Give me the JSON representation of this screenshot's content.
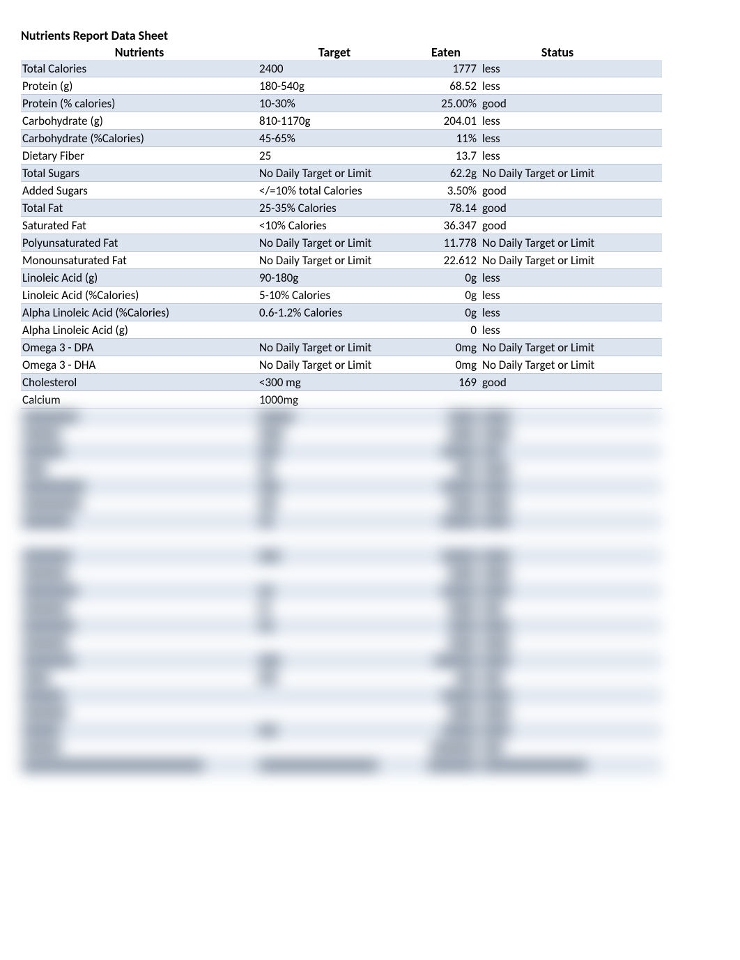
{
  "title": "Nutrients Report Data Sheet",
  "headers": {
    "nutrients": "Nutrients",
    "target": "Target",
    "eaten": "Eaten",
    "status": "Status"
  },
  "rows": [
    {
      "nutrient": "Total Calories",
      "target": "2400",
      "eaten": "1777",
      "status": "less",
      "alt": true
    },
    {
      "nutrient": "Protein (g)",
      "target": "180-540g",
      "eaten": "68.52",
      "status": "less",
      "alt": false
    },
    {
      "nutrient": "Protein (% calories)",
      "target": "10-30%",
      "eaten": "25.00%",
      "status": "good",
      "alt": true
    },
    {
      "nutrient": "Carbohydrate (g)",
      "target": "810-1170g",
      "eaten": "204.01",
      "status": "less",
      "alt": false
    },
    {
      "nutrient": "Carbohydrate (%Calories)",
      "target": "45-65%",
      "eaten": "11%",
      "status": "less",
      "alt": true
    },
    {
      "nutrient": "Dietary Fiber",
      "target": "25",
      "eaten": "13.7",
      "status": "less",
      "alt": false
    },
    {
      "nutrient": "Total Sugars",
      "target": "No Daily Target or Limit",
      "eaten": "62.2g",
      "status": "No Daily Target or Limit",
      "alt": true
    },
    {
      "nutrient": "Added Sugars",
      "target": "</=10% total Calories",
      "eaten": "3.50%",
      "status": "good",
      "alt": false
    },
    {
      "nutrient": "Total Fat",
      "target": "25-35% Calories",
      "eaten": "78.14",
      "status": "good",
      "alt": true
    },
    {
      "nutrient": "Saturated Fat",
      "target": "<10%  Calories",
      "eaten": "36.347",
      "status": "good",
      "alt": false
    },
    {
      "nutrient": "Polyunsaturated Fat",
      "target": "No Daily Target or Limit",
      "eaten": "11.778",
      "status": "No Daily Target or Limit",
      "alt": true
    },
    {
      "nutrient": "Monounsaturated Fat",
      "target": "No Daily Target or Limit",
      "eaten": "22.612",
      "status": "No Daily Target or Limit",
      "alt": false
    },
    {
      "nutrient": "Linoleic Acid (g)",
      "target": "90-180g",
      "eaten": "0g",
      "status": "less",
      "alt": true
    },
    {
      "nutrient": "Linoleic Acid (%Calories)",
      "target": "5-10% Calories",
      "eaten": "0g",
      "status": "less",
      "alt": false
    },
    {
      "nutrient": "Alpha Linoleic Acid (%Calories)",
      "target": "0.6-1.2% Calories",
      "eaten": "0g",
      "status": "less",
      "alt": true
    },
    {
      "nutrient": "Alpha Linoleic Acid (g)",
      "target": "",
      "eaten": "0",
      "status": "less",
      "alt": false
    },
    {
      "nutrient": "Omega 3 - DPA",
      "target": "No Daily Target or Limit",
      "eaten": "0mg",
      "status": "No Daily Target or Limit",
      "alt": true
    },
    {
      "nutrient": "Omega 3 - DHA",
      "target": "No Daily Target or Limit",
      "eaten": "0mg",
      "status": "No Daily Target or Limit",
      "alt": false
    },
    {
      "nutrient": "Cholesterol",
      "target": "<300 mg",
      "eaten": "169",
      "status": "good",
      "alt": true
    },
    {
      "nutrient": "Calcium",
      "target": "1000mg",
      "eaten": "",
      "status": "",
      "alt": false
    }
  ]
}
